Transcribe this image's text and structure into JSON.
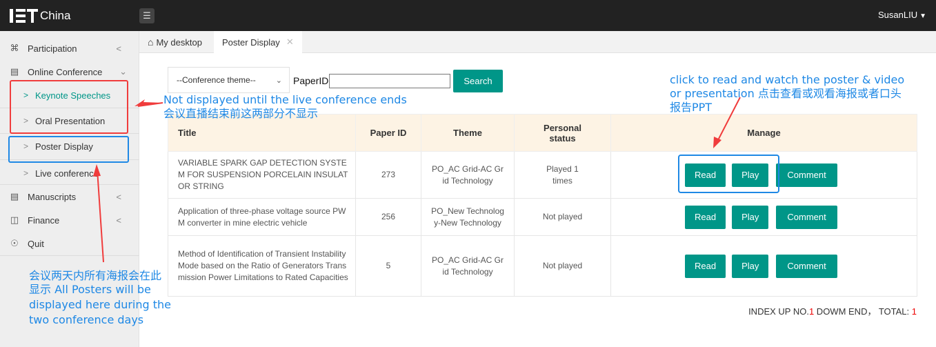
{
  "header": {
    "logo_text": "China",
    "menu_icon": "hamburger-icon",
    "user": "SusanLIU"
  },
  "sidebar": {
    "items": [
      {
        "label": "Participation",
        "icon": "cluster-icon"
      },
      {
        "label": "Online Conference",
        "icon": "document-icon"
      },
      {
        "label": "Keynote Speeches"
      },
      {
        "label": "Oral Presentation"
      },
      {
        "label": "Poster Display"
      },
      {
        "label": "Live conference"
      },
      {
        "label": "Manuscripts",
        "icon": "document-icon"
      },
      {
        "label": "Finance",
        "icon": "finance-icon"
      },
      {
        "label": "Quit",
        "icon": "power-icon"
      }
    ]
  },
  "tabs": [
    {
      "label": "My desktop",
      "icon": "home-icon"
    },
    {
      "label": "Poster Display"
    }
  ],
  "search": {
    "theme_select": "--Conference theme--",
    "paper_label": "PaperID",
    "paper_value": "",
    "button": "Search"
  },
  "table": {
    "headers": [
      "Title",
      "Paper ID",
      "Theme",
      "Personal status",
      "Manage"
    ],
    "rows": [
      {
        "title": "VARIABLE SPARK GAP DETECTION SYSTEM FOR SUSPENSION PORCELAIN INSULATOR STRING",
        "paper_id": "273",
        "theme": "PO_AC Grid-AC Grid Technology",
        "status": "Played 1 times"
      },
      {
        "title": "Application of three-phase voltage source PWM converter in mine electric vehicle",
        "paper_id": "256",
        "theme": "PO_New Technology-New Technology",
        "status": "Not played"
      },
      {
        "title": "Method of Identification of Transient Instability Mode based on the Ratio of Generators Transmission Power Limitations to Rated Capacities",
        "paper_id": "5",
        "theme": "PO_AC Grid-AC Grid Technology",
        "status": "Not played"
      }
    ],
    "actions": {
      "read": "Read",
      "play": "Play",
      "comment": "Comment"
    }
  },
  "pager": {
    "prefix": "INDEX UP NO.",
    "page": "1",
    "middle": " DOWM END， TOTAL: ",
    "total": "1"
  },
  "annotations": {
    "not_displayed_en": "Not displayed until the live conference ends",
    "not_displayed_cn": "会议直播结束前这两部分不显示",
    "click_en_1": "click to read and watch the poster & video",
    "click_en_2": "or presentation 点击查看或观看海报或者口头",
    "click_cn": "报告PPT",
    "posters_1": "会议两天内所有海报会在此",
    "posters_2": "显示 All Posters will be",
    "posters_3": "displayed here during the",
    "posters_4": "two conference days"
  },
  "colors": {
    "primary": "#009688",
    "topbar": "#222222",
    "annotation_red": "#f03c3c",
    "annotation_blue": "#1e88e5",
    "header_bg": "#fdf3e4"
  }
}
